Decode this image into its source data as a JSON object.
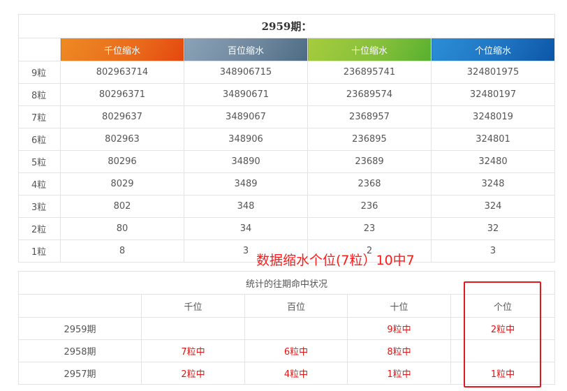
{
  "period_title": "2959期：",
  "columns": [
    {
      "label": "千位缩水",
      "color": "#e96a1c"
    },
    {
      "label": "百位缩水",
      "color": "#6f889e"
    },
    {
      "label": "十位缩水",
      "color": "#86c03b"
    },
    {
      "label": "个位缩水",
      "color": "#1f74c2"
    }
  ],
  "rows": [
    {
      "label": "9粒",
      "values": [
        "802963714",
        "348906715",
        "236895741",
        "324801975"
      ]
    },
    {
      "label": "8粒",
      "values": [
        "80296371",
        "34890671",
        "23689574",
        "32480197"
      ]
    },
    {
      "label": "7粒",
      "values": [
        "8029637",
        "3489067",
        "2368957",
        "3248019"
      ]
    },
    {
      "label": "6粒",
      "values": [
        "802963",
        "348906",
        "236895",
        "324801"
      ]
    },
    {
      "label": "5粒",
      "values": [
        "80296",
        "34890",
        "23689",
        "32480"
      ]
    },
    {
      "label": "4粒",
      "values": [
        "8029",
        "3489",
        "2368",
        "3248"
      ]
    },
    {
      "label": "3粒",
      "values": [
        "802",
        "348",
        "236",
        "324"
      ]
    },
    {
      "label": "2粒",
      "values": [
        "80",
        "34",
        "23",
        "32"
      ]
    },
    {
      "label": "1粒",
      "values": [
        "8",
        "3",
        "2",
        "3"
      ]
    }
  ],
  "annotation": "数据缩水个位(7粒）10中7",
  "stats": {
    "title": "统计的往期命中状况",
    "headers": [
      "千位",
      "百位",
      "十位",
      "个位"
    ],
    "rows": [
      {
        "period": "2959期",
        "values": [
          "",
          "",
          "9粒中",
          "2粒中"
        ]
      },
      {
        "period": "2958期",
        "values": [
          "7粒中",
          "6粒中",
          "8粒中",
          ""
        ]
      },
      {
        "period": "2957期",
        "values": [
          "2粒中",
          "4粒中",
          "1粒中",
          "1粒中"
        ]
      }
    ],
    "hit_color": "#e01515"
  },
  "highlight_color": "#e0191e"
}
